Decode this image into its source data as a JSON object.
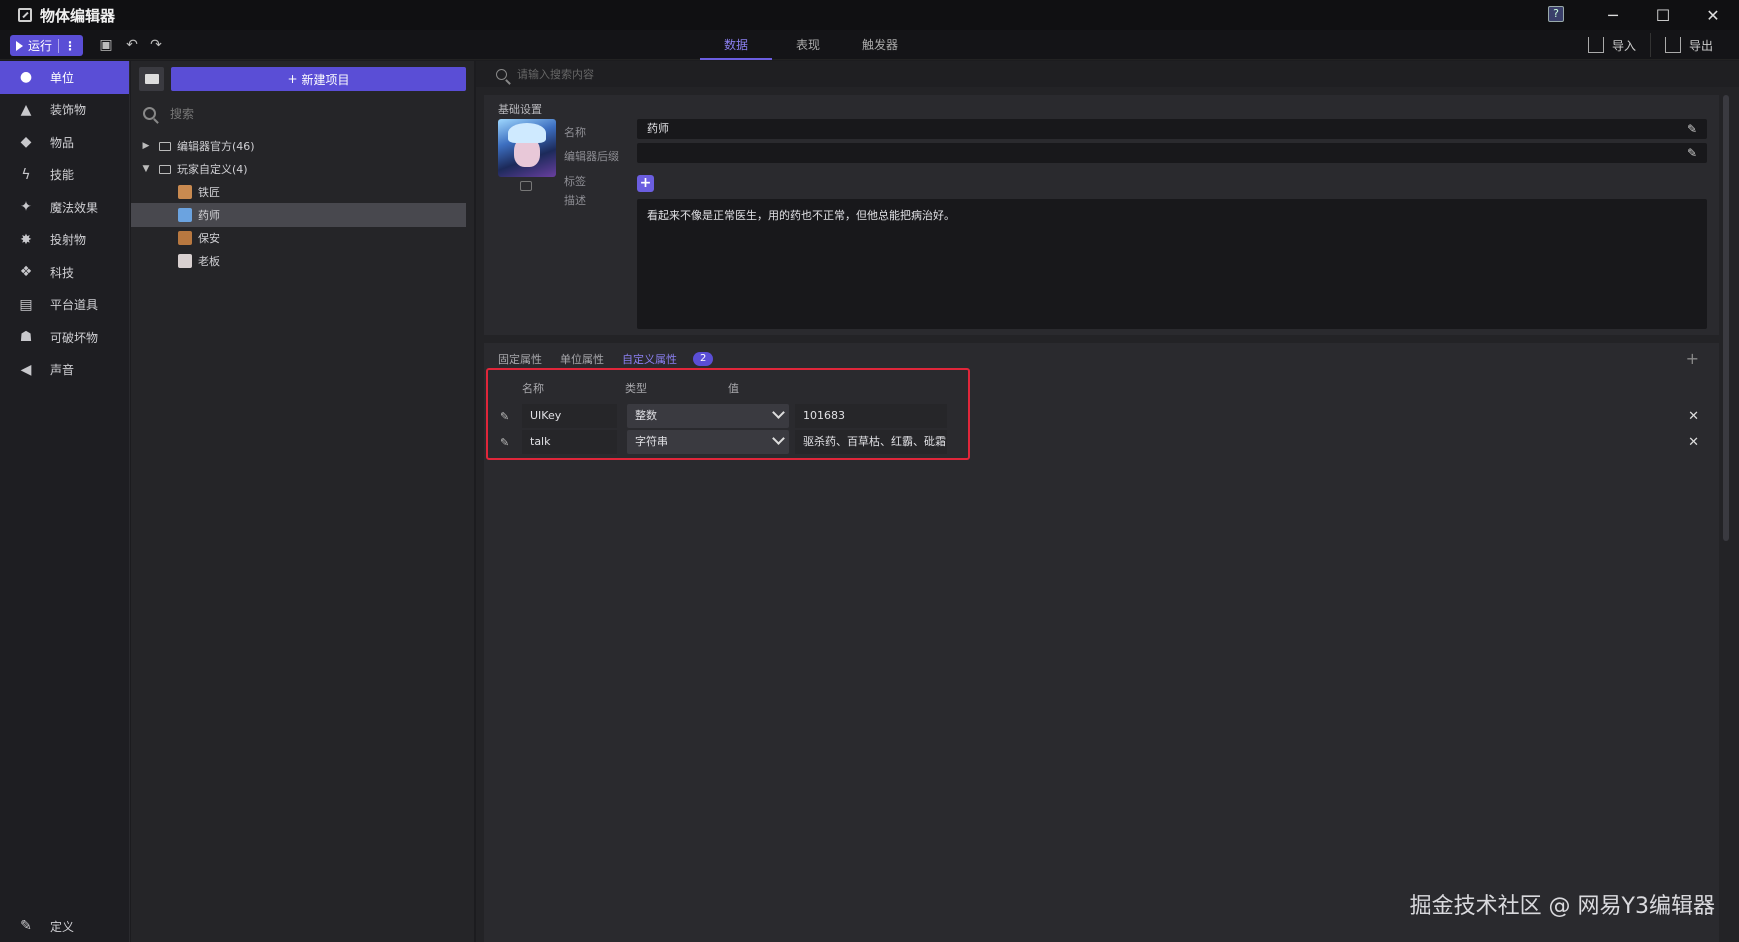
{
  "window": {
    "title": "物体编辑器"
  },
  "toolbar": {
    "run_label": "运行",
    "import_label": "导入",
    "export_label": "导出"
  },
  "tabs": [
    {
      "label": "数据",
      "active": true
    },
    {
      "label": "表现",
      "active": false
    },
    {
      "label": "触发器",
      "active": false
    }
  ],
  "nav": {
    "items": [
      {
        "label": "单位",
        "icon": "person-icon",
        "active": true
      },
      {
        "label": "装饰物",
        "icon": "tree-icon",
        "active": false
      },
      {
        "label": "物品",
        "icon": "box-icon",
        "active": false
      },
      {
        "label": "技能",
        "icon": "lightning-icon",
        "active": false
      },
      {
        "label": "魔法效果",
        "icon": "sparkle-icon",
        "active": false
      },
      {
        "label": "投射物",
        "icon": "projectile-icon",
        "active": false
      },
      {
        "label": "科技",
        "icon": "tech-icon",
        "active": false
      },
      {
        "label": "平台道具",
        "icon": "platform-icon",
        "active": false
      },
      {
        "label": "可破坏物",
        "icon": "destructible-icon",
        "active": false
      },
      {
        "label": "声音",
        "icon": "speaker-icon",
        "active": false
      }
    ],
    "bottom_label": "定义"
  },
  "tree": {
    "new_item_label": "新建项目",
    "search_placeholder": "搜索",
    "groups": [
      {
        "label": "编辑器官方(46)",
        "expanded": false
      },
      {
        "label": "玩家自定义(4)",
        "expanded": true
      }
    ],
    "units": [
      {
        "label": "铁匠",
        "selected": false,
        "color": "#c98a50"
      },
      {
        "label": "药师",
        "selected": true,
        "color": "#6ba3e0"
      },
      {
        "label": "保安",
        "selected": false,
        "color": "#b87840"
      },
      {
        "label": "老板",
        "selected": false,
        "color": "#d8d0d0"
      }
    ]
  },
  "main": {
    "search_placeholder": "请输入搜索内容",
    "basic": {
      "section_title": "基础设置",
      "name_label": "名称",
      "name_value": "药师",
      "suffix_label": "编辑器后缀",
      "suffix_value": "",
      "tag_label": "标签",
      "desc_label": "描述",
      "desc_value": "看起来不像是正常医生，用的药也不正常，但他总能把病治好。"
    },
    "props": {
      "tabs": [
        {
          "label": "固定属性",
          "active": false
        },
        {
          "label": "单位属性",
          "active": false
        },
        {
          "label": "自定义属性",
          "active": true
        }
      ],
      "count": "2",
      "col_name": "名称",
      "col_type": "类型",
      "col_value": "值",
      "rows": [
        {
          "name": "UIKey",
          "type": "整数",
          "value": "101683"
        },
        {
          "name": "talk",
          "type": "字符串",
          "value": "驱杀药、百草枯、红霸、砒霜~"
        }
      ]
    }
  },
  "watermark": "掘金技术社区 @ 网易Y3编辑器",
  "colors": {
    "accent": "#5a4ed6",
    "highlight": "#e0263a"
  }
}
